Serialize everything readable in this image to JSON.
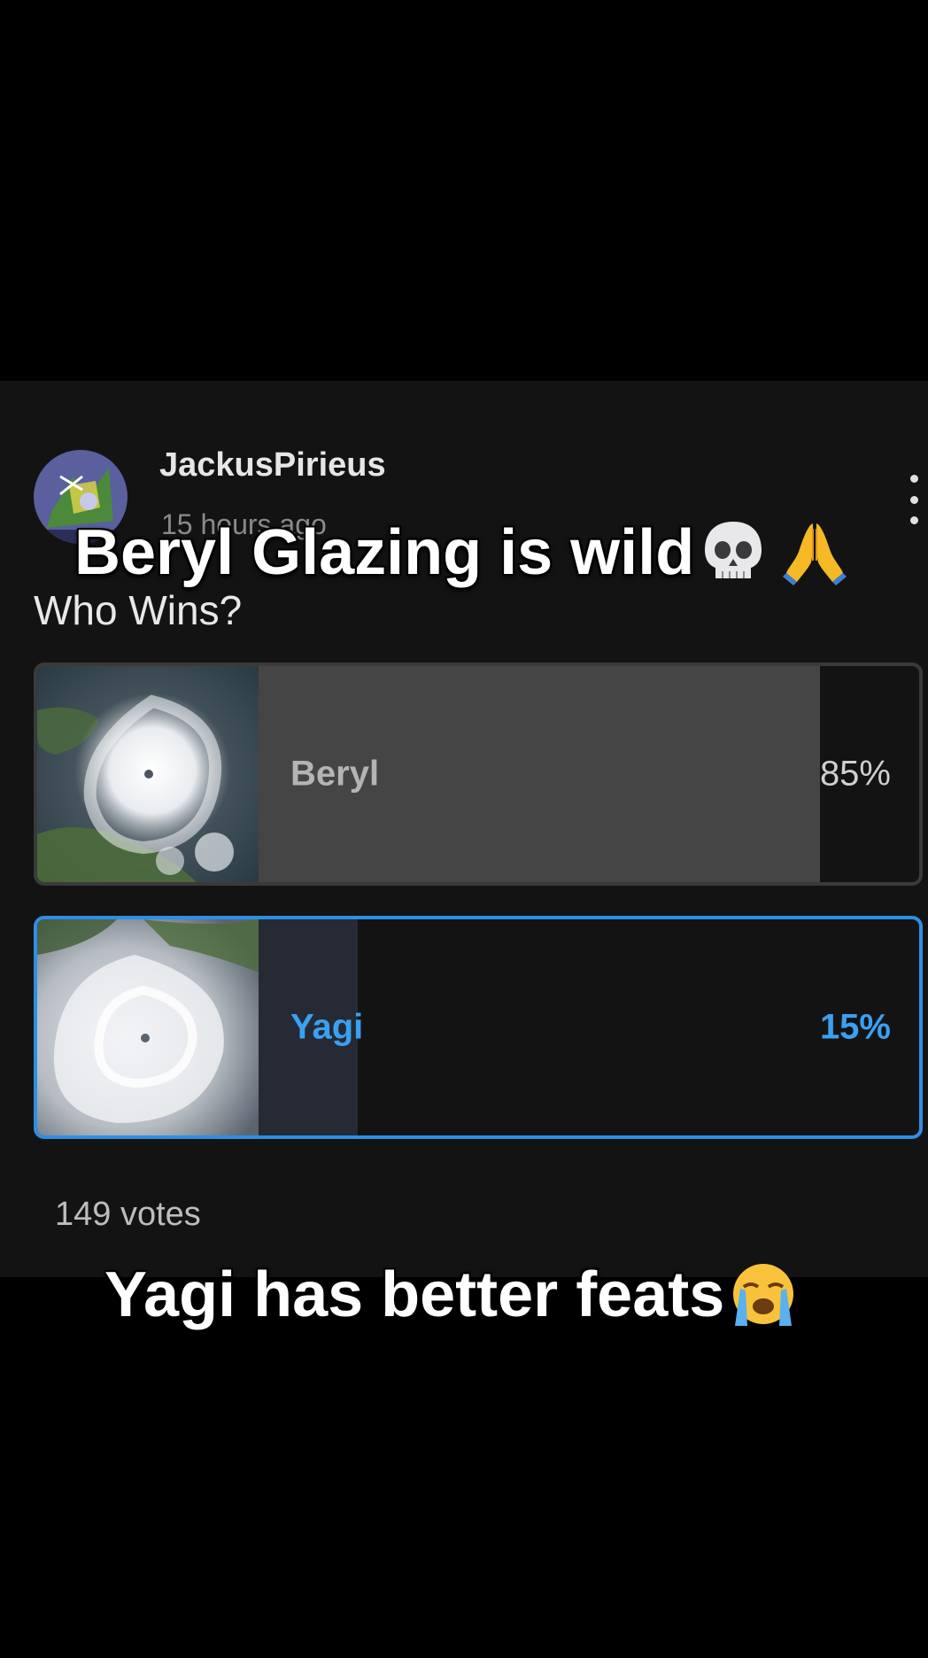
{
  "post": {
    "author": "JackusPirieus",
    "timestamp": "15 hours ago",
    "more_icon": "more-vertical-icon"
  },
  "poll": {
    "question": "Who Wins?",
    "options": [
      {
        "label": "Beryl",
        "percent_text": "85%",
        "percent": 85,
        "selected": false,
        "image": "hurricane-beryl-satellite-image"
      },
      {
        "label": "Yagi",
        "percent_text": "15%",
        "percent": 15,
        "selected": true,
        "image": "typhoon-yagi-satellite-image"
      }
    ],
    "votes_text": "149 votes"
  },
  "overlay": {
    "caption_top": "Beryl Glazing is wild",
    "caption_top_emojis": [
      "skull-emoji",
      "folded-hands-emoji"
    ],
    "caption_bottom": "Yagi has better feats",
    "caption_bottom_emojis": [
      "loudly-crying-face-emoji"
    ]
  },
  "colors": {
    "background": "#000000",
    "card": "#131313",
    "accent_blue": "#2d8ee6",
    "beryl_fill": "#454545",
    "yagi_fill": "#252a35"
  }
}
